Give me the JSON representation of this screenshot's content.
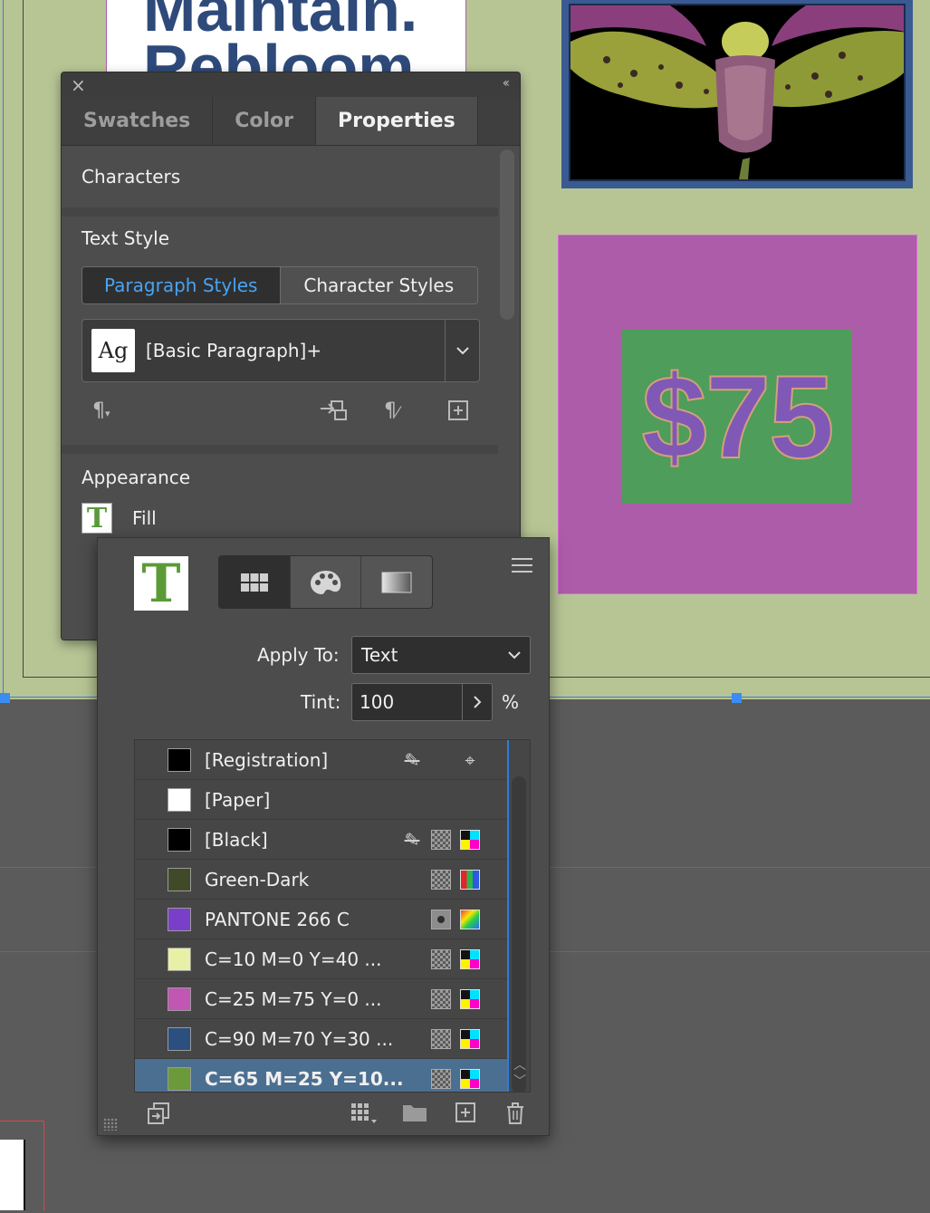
{
  "document": {
    "headline": "Maintain.\nRebloom.",
    "price": "$75"
  },
  "properties_panel": {
    "tabs": [
      {
        "label": "Swatches",
        "active": false
      },
      {
        "label": "Color",
        "active": false
      },
      {
        "label": "Properties",
        "active": true
      }
    ],
    "characters_title": "Characters",
    "text_style_title": "Text Style",
    "paragraph_styles_label": "Paragraph Styles",
    "character_styles_label": "Character Styles",
    "style_thumb": "Ag",
    "style_value": "[Basic Paragraph]+",
    "appearance_title": "Appearance",
    "fill_label": "Fill",
    "fill_icon_letter": "T"
  },
  "swatch_flyout": {
    "preview_letter": "T",
    "apply_to_label": "Apply To:",
    "apply_to_value": "Text",
    "tint_label": "Tint:",
    "tint_value": "100",
    "tint_unit": "%",
    "swatches": [
      {
        "name": "[Registration]",
        "color": "#000000",
        "icons": [
          "no-edit-icon",
          "registration-icon"
        ],
        "selected": false
      },
      {
        "name": "[Paper]",
        "color": "#ffffff",
        "icons": [],
        "selected": false
      },
      {
        "name": "[Black]",
        "color": "#000000",
        "icons": [
          "no-edit-icon",
          "process-icon",
          "cmyk-icon"
        ],
        "selected": false
      },
      {
        "name": "Green-Dark",
        "color": "#414a28",
        "icons": [
          "process-icon",
          "rgb-icon"
        ],
        "selected": false
      },
      {
        "name": "PANTONE 266 C",
        "color": "#7a3fc9",
        "icons": [
          "spot-icon",
          "lab-icon"
        ],
        "selected": false
      },
      {
        "name": "C=10 M=0 Y=40 ...",
        "color": "#e8f0a8",
        "icons": [
          "process-icon",
          "cmyk-icon"
        ],
        "selected": false
      },
      {
        "name": "C=25 M=75 Y=0 ...",
        "color": "#c156b3",
        "icons": [
          "process-icon",
          "cmyk-icon"
        ],
        "selected": false
      },
      {
        "name": "C=90 M=70 Y=30 ...",
        "color": "#2b4f7e",
        "icons": [
          "process-icon",
          "cmyk-icon"
        ],
        "selected": false
      },
      {
        "name": "C=65 M=25 Y=10...",
        "color": "#6a9a3a",
        "icons": [
          "process-icon",
          "cmyk-icon"
        ],
        "selected": true
      }
    ]
  },
  "colors": {
    "accent": "#49a3f2",
    "selection": "#4b6f91",
    "page": "#b7c595",
    "price_bg": "#ad5ca9",
    "price_box": "#4e9d5a",
    "price_text": "#8059b6"
  }
}
